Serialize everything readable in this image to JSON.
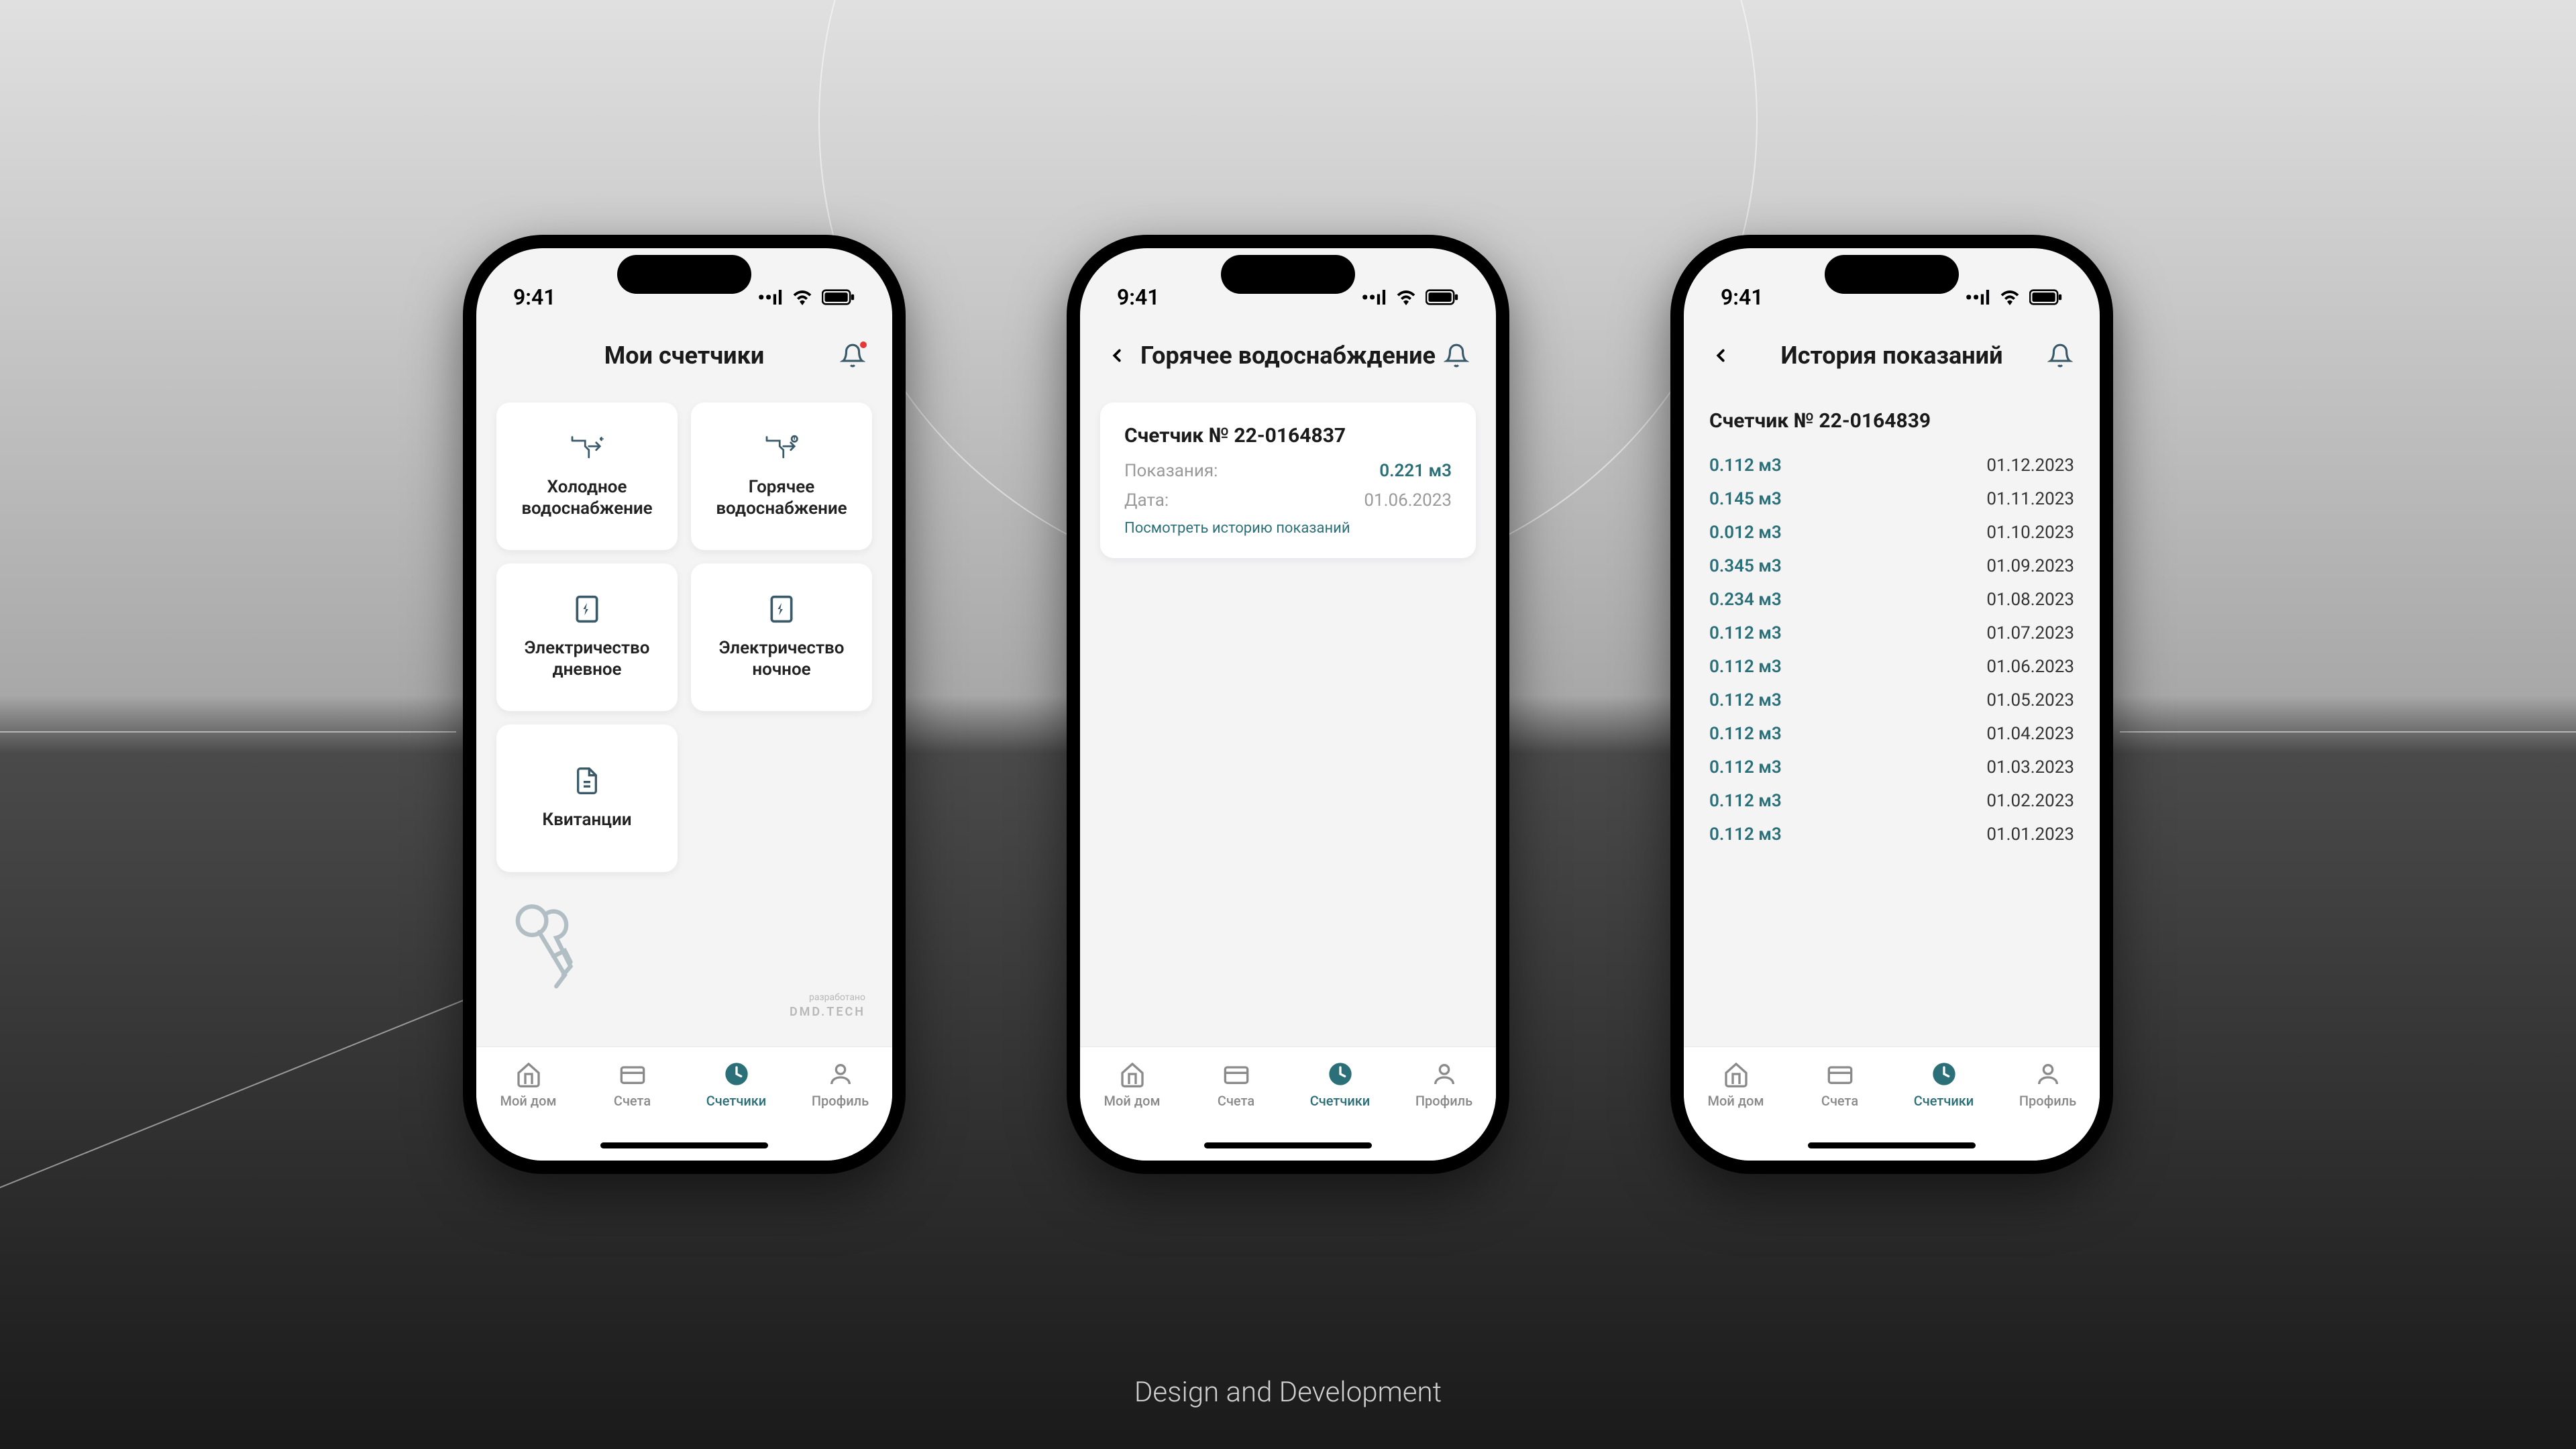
{
  "status": {
    "time": "9:41"
  },
  "caption": "Design and Development",
  "tabs": {
    "home": "Мой дом",
    "bills": "Счета",
    "meters": "Счетчики",
    "profile": "Профиль"
  },
  "screen1": {
    "title": "Мои счетчики",
    "tiles": {
      "cold": "Холодное водоснабжение",
      "hot": "Горячее водоснабжение",
      "elec_day": "Электричество дневное",
      "elec_night": "Электричество ночное",
      "receipts": "Квитанции"
    },
    "footer": {
      "line1": "разработано",
      "line2": "DMD.TECH"
    }
  },
  "screen2": {
    "title": "Горячее водоснабждение",
    "meter_label": "Счетчик № 22-0164837",
    "reading_label": "Показания:",
    "reading_value": "0.221 м3",
    "date_label": "Дата:",
    "date_value": "01.06.2023",
    "history_link": "Посмотреть историю показаний"
  },
  "screen3": {
    "title": "История показаний",
    "meter_label": "Счетчик № 22-0164839",
    "rows": [
      {
        "v": "0.112 м3",
        "d": "01.12.2023"
      },
      {
        "v": "0.145 м3",
        "d": "01.11.2023"
      },
      {
        "v": "0.012 м3",
        "d": "01.10.2023"
      },
      {
        "v": "0.345 м3",
        "d": "01.09.2023"
      },
      {
        "v": "0.234 м3",
        "d": "01.08.2023"
      },
      {
        "v": "0.112 м3",
        "d": "01.07.2023"
      },
      {
        "v": "0.112 м3",
        "d": "01.06.2023"
      },
      {
        "v": "0.112 м3",
        "d": "01.05.2023"
      },
      {
        "v": "0.112 м3",
        "d": "01.04.2023"
      },
      {
        "v": "0.112 м3",
        "d": "01.03.2023"
      },
      {
        "v": "0.112 м3",
        "d": "01.02.2023"
      },
      {
        "v": "0.112 м3",
        "d": "01.01.2023"
      }
    ]
  }
}
